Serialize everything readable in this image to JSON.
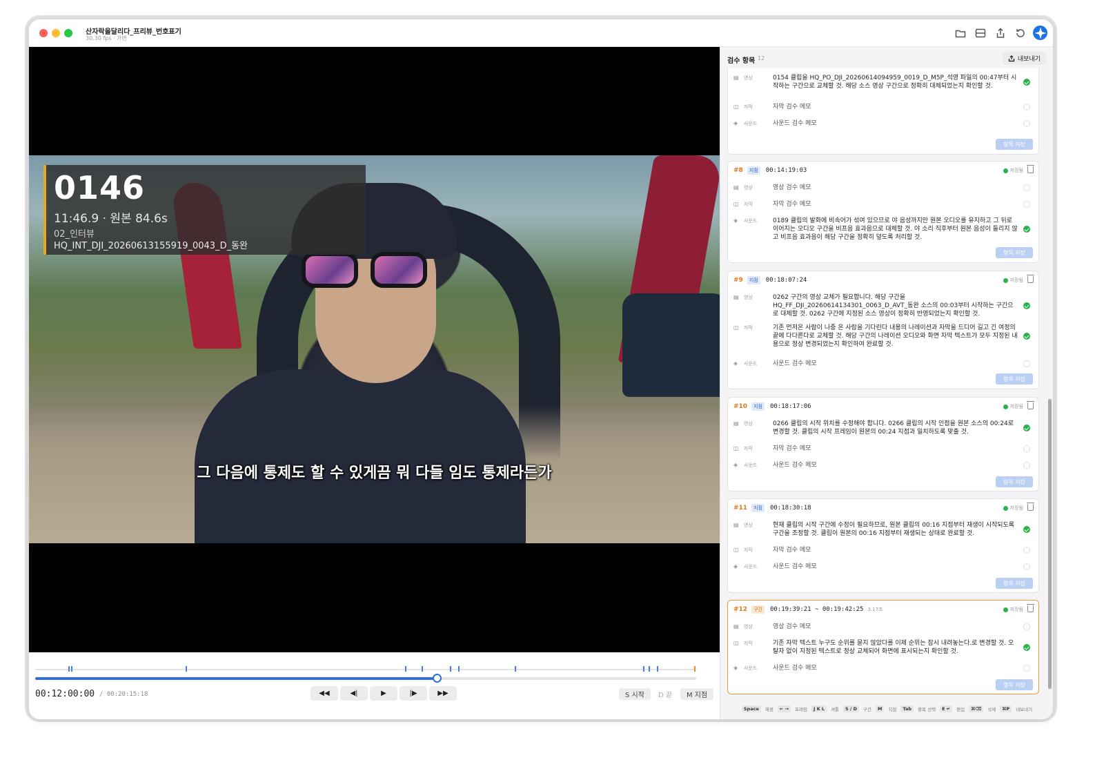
{
  "window": {
    "title": "산자락을달리다_프리뷰_번호표기",
    "subtitle": "30.30 fps · 가변"
  },
  "video": {
    "overlay": {
      "clip_number": "0146",
      "time_line": "11:46.9  ·  원본 84.6s",
      "category": "02_인터뷰",
      "source_file": "HQ_INT_DJI_20260613155919_0043_D_동완"
    },
    "subtitle": "그 다음에 통제도 할 수 있게끔 뭐 다들 임도 통제라든가"
  },
  "transport": {
    "current_timecode": "00:12:00:00",
    "total_timecode": "/ 00:20:15:18",
    "progress": 0.607,
    "markers": [
      0.05,
      0.054,
      0.228,
      0.559,
      0.585,
      0.627,
      0.64,
      0.725,
      0.92,
      0.928,
      0.941
    ],
    "orange_markers": [
      0.999
    ],
    "controls": [
      "◀◀",
      "◀|",
      "▶",
      "|▶",
      "▶▶"
    ],
    "mark_start": "S 시작",
    "mark_end": "D 끝",
    "mark_point": "M 지점"
  },
  "panel": {
    "title": "검수 항목",
    "count": "12",
    "export_label": "내보내기",
    "row_labels": {
      "video": "영상",
      "subtitle": "자막",
      "sound": "사운드"
    },
    "save_label": "항목 저장",
    "saved_label": "저장됨",
    "cards": [
      {
        "rows": [
          {
            "kind": "video",
            "text": "0154 클립을 HQ_PO_DJI_20260614094959_0019_D_M5P_석영 파일의 00:47부터 시작하는 구간으로 교체할 것. 해당 소스 영상 구간으로 정확히 대체되었는지 확인할 것.",
            "done": true
          },
          {
            "kind": "subtitle",
            "text": "자막 검수 메모",
            "done": false
          },
          {
            "kind": "sound",
            "text": "사운드 검수 메모",
            "done": false
          }
        ]
      },
      {
        "id": "#8",
        "tag": "지점",
        "time": "00:14:19:03",
        "rows": [
          {
            "kind": "video",
            "text": "영상 검수 메모",
            "done": false
          },
          {
            "kind": "subtitle",
            "text": "자막 검수 메모",
            "done": false
          },
          {
            "kind": "sound",
            "text": "0189 클립의 발화에 비속어가 섞여 있으므로 야 음성까지만 원본 오디오를 유지하고 그 뒤로 이어지는 오디오 구간을 비프음 효과음으로 대체할 것. 야 소리 직후부터 원본 음성이 들리지 않고 비프음 효과음이 해당 구간을 정확히 덮도록 처리할 것.",
            "done": true
          }
        ]
      },
      {
        "id": "#9",
        "tag": "지점",
        "time": "00:18:07:24",
        "rows": [
          {
            "kind": "video",
            "text": "0262 구간의 영상 교체가 필요합니다. 해당 구간을 HQ_FF_DJI_20260614134301_0063_D_AVT_동완 소스의 00:03부터 시작하는 구간으로 대체할 것. 0262 구간에 지정된 소스 영상이 정확히 반영되었는지 확인할 것.",
            "done": true
          },
          {
            "kind": "subtitle",
            "text": "기존 먼저온 사람이 나중 온 사람을 기다린다 내용의 나레이션과 자막을 드디어 길고 긴 여정의 끝에 다다른다로 교체할 것. 해당 구간의 나레이션 오디오와 화면 자막 텍스트가 모두 지정된 내용으로 정상 변경되었는지 확인하여 완료할 것.",
            "done": true
          },
          {
            "kind": "sound",
            "text": "사운드 검수 메모",
            "done": false
          }
        ]
      },
      {
        "id": "#10",
        "tag": "지점",
        "time": "00:18:17:06",
        "rows": [
          {
            "kind": "video",
            "text": "0266 클립의 시작 위치를 수정해야 합니다. 0266 클립의 시작 인점을 원본 소스의 00:24로 변경할 것. 클립의 시작 프레임이 원본의 00:24 지점과 일치하도록 맞출 것.",
            "done": true
          },
          {
            "kind": "subtitle",
            "text": "자막 검수 메모",
            "done": false
          },
          {
            "kind": "sound",
            "text": "사운드 검수 메모",
            "done": false
          }
        ]
      },
      {
        "id": "#11",
        "tag": "지점",
        "time": "00:18:30:18",
        "rows": [
          {
            "kind": "video",
            "text": "현재 클립의 시작 구간에 수정이 필요하므로, 원본 클립의 00:16 지점부터 재생이 시작되도록 구간을 조정할 것. 클립이 원본의 00:16 지점부터 재생되는 상태로 완료할 것.",
            "done": true
          },
          {
            "kind": "subtitle",
            "text": "자막 검수 메모",
            "done": false
          },
          {
            "kind": "sound",
            "text": "사운드 검수 메모",
            "done": false
          }
        ]
      },
      {
        "id": "#12",
        "tag": "구간",
        "time": "00:19:39:21 ~ 00:19:42:25",
        "duration": "3.17초",
        "rows": [
          {
            "kind": "video",
            "text": "영상 검수 메모",
            "done": false
          },
          {
            "kind": "subtitle",
            "text": "기존 자막 텍스트 누구도 순위를 묻지 않았다를 이제 순위는 잠시 내려놓는다.로 변경할 것. 오탈자 없이 지정된 텍스트로 정상 교체되어 화면에 표시되는지 확인할 것.",
            "done": true
          },
          {
            "kind": "sound",
            "text": "사운드 검수 메모",
            "done": false
          }
        ]
      }
    ]
  },
  "shortcuts": [
    {
      "key": "Space",
      "label": "재생"
    },
    {
      "key": "← →",
      "label": "프레임"
    },
    {
      "key": "J K L",
      "label": "셔틀"
    },
    {
      "key": "S / D",
      "label": "구간"
    },
    {
      "key": "M",
      "label": "지점"
    },
    {
      "key": "Tab",
      "label": "항목 선택"
    },
    {
      "key": "E ↵",
      "label": "편집"
    },
    {
      "key": "⌘⌫",
      "label": "삭제"
    },
    {
      "key": "⌘P",
      "label": "내보내기"
    }
  ],
  "colors": {
    "accent": "#2e6fe0",
    "marker_orange": "#e98a1f",
    "done_green": "#2ab24c",
    "card_id": "#e07a1f",
    "overlay_bar": "#e5a823"
  },
  "icons": {
    "video": "film-icon",
    "subtitle": "speech-bubble-icon",
    "sound": "speaker-icon"
  }
}
